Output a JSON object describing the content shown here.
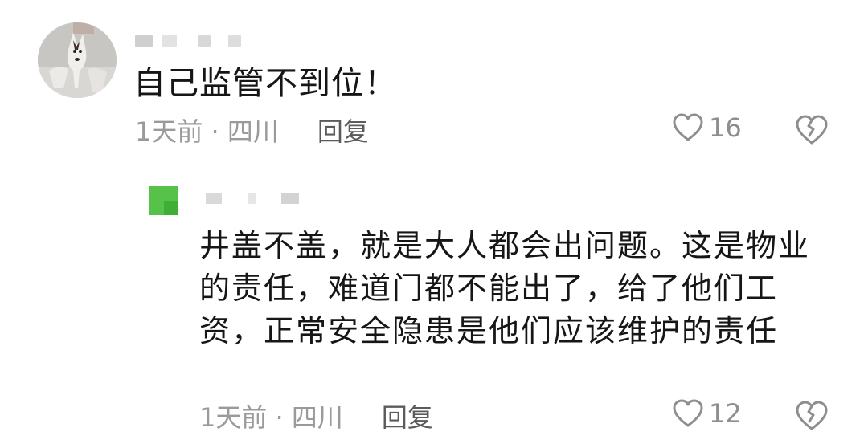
{
  "comments": [
    {
      "text": "自己监管不到位！",
      "time_location": "1天前 · 四川",
      "reply_label": "回复",
      "likes": "16",
      "icons": {
        "like": "heart-outline-icon",
        "dislike": "broken-heart-icon"
      }
    },
    {
      "text": "井盖不盖，就是大人都会出问题。这是物业的责任，难道门都不能出了，给了他们工资，正常安全隐患是他们应该维护的责任",
      "time_location": "1天前 · 四川",
      "reply_label": "回复",
      "likes": "12",
      "icons": {
        "like": "heart-outline-icon",
        "dislike": "broken-heart-icon"
      }
    }
  ],
  "colors": {
    "text": "#161616",
    "meta": "#9a9a9a",
    "reply": "#5b5b5b",
    "icon": "#8e8e8e",
    "reply_avatar": "#57c24a"
  }
}
